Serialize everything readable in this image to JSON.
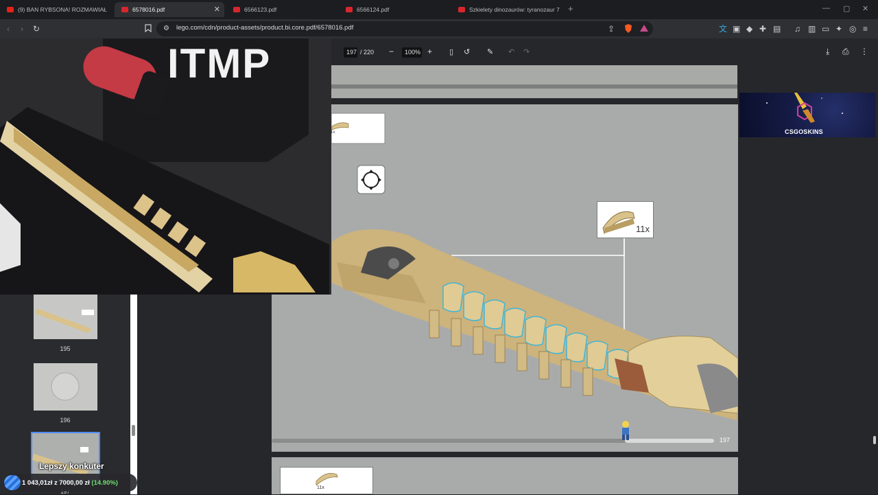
{
  "tabs": [
    {
      "title": "(9) BAN RYBSONA! ROZMAWIAŁ Z D",
      "active": false,
      "favicon_color": "#e62117"
    },
    {
      "title": "6578016.pdf",
      "active": true,
      "favicon_color": "#d8262d"
    },
    {
      "title": "6566123.pdf",
      "active": false,
      "favicon_color": "#d8262d"
    },
    {
      "title": "6566124.pdf",
      "active": false,
      "favicon_color": "#d8262d"
    },
    {
      "title": "Szkielety dinozaurów: tyranozaur 769",
      "active": false,
      "favicon_color": "#d8262d"
    }
  ],
  "toolbar": {
    "url": "lego.com/cdn/product-assets/product.bi.core.pdf/6578016.pdf",
    "notification_count": "1"
  },
  "pdf": {
    "page_current": "197",
    "page_total": "/ 220",
    "zoom": "100%",
    "page_label": "197",
    "callout_count": "11x",
    "prev_callout_count": "1x",
    "next_callout_count": "11x"
  },
  "sidebar": {
    "thumbnails": [
      {
        "label": "195"
      },
      {
        "label": "196"
      },
      {
        "label": "197"
      }
    ]
  },
  "overlay": {
    "webcam_shirt_text": "ITMP",
    "stream_caption": "Lepszy konkuter",
    "donation_text": "1 043,01zł z 7000,00 zł",
    "donation_percent": "(14.90%)",
    "ad_brand": "CSGOSKINS"
  },
  "colors": {
    "accent": "#4f8cff",
    "brick_tan": "#d9c28b",
    "highlight_blue": "#3fb6d9",
    "donation_green": "#6ee06b"
  }
}
